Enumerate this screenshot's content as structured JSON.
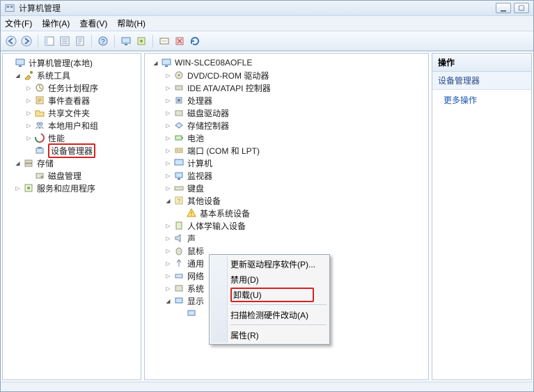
{
  "window": {
    "title": "计算机管理",
    "buttons": {
      "min": "▁",
      "max": "▢"
    }
  },
  "menu": {
    "file": "文件(F)",
    "action": "操作(A)",
    "view": "查看(V)",
    "help": "帮助(H)"
  },
  "leftTree": {
    "root": "计算机管理(本地)",
    "systemTools": "系统工具",
    "taskScheduler": "任务计划程序",
    "eventViewer": "事件查看器",
    "sharedFolders": "共享文件夹",
    "localUsers": "本地用户和组",
    "performance": "性能",
    "deviceManager": "设备管理器",
    "storage": "存储",
    "diskMgmt": "磁盘管理",
    "services": "服务和应用程序"
  },
  "midTree": {
    "host": "WIN-SLCE08AOFLE",
    "dvd": "DVD/CD-ROM 驱动器",
    "ide": "IDE ATA/ATAPI 控制器",
    "cpu": "处理器",
    "diskdrive": "磁盘驱动器",
    "storagectrl": "存储控制器",
    "battery": "电池",
    "ports": "端口 (COM 和 LPT)",
    "computer": "计算机",
    "monitor": "监视器",
    "keyboard": "键盘",
    "other": "其他设备",
    "basicSys": "基本系统设备",
    "hid": "人体学输入设备",
    "sound": "声",
    "mouse": "鼠标",
    "usb": "通用",
    "net": "网络",
    "sys": "系统",
    "display": "显示"
  },
  "rightPane": {
    "header": "操作",
    "section": "设备管理器",
    "more": "更多操作"
  },
  "contextMenu": {
    "update": "更新驱动程序软件(P)...",
    "disable": "禁用(D)",
    "uninstall": "卸载(U)",
    "scan": "扫描检测硬件改动(A)",
    "properties": "属性(R)"
  }
}
